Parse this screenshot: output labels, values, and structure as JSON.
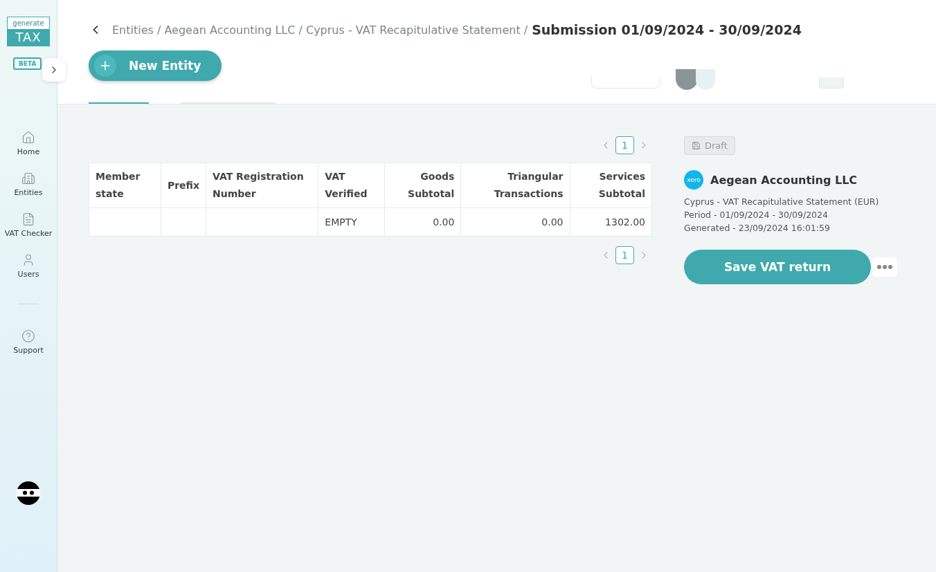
{
  "sidebar": {
    "logo_top": "generate",
    "logo_bottom": "TAX",
    "badge": "BETA",
    "items": [
      {
        "label": "Home"
      },
      {
        "label": "Entities"
      },
      {
        "label": "VAT Checker"
      },
      {
        "label": "Users"
      }
    ],
    "support": {
      "label": "Support"
    }
  },
  "breadcrumb": {
    "path": "Entities / Aegean Accounting LLC / Cyprus - VAT Recapitulative Statement /",
    "current": "Submission 01/09/2024 - 30/09/2024"
  },
  "new_entity_button": "New Entity",
  "tabs": [
    {
      "selected": true
    },
    {
      "selected": false
    }
  ],
  "pagination_top": {
    "page": "1"
  },
  "table": {
    "columns": [
      "Member state",
      "Prefix",
      "VAT Registration Number",
      "VAT Verified",
      "Goods Subtotal",
      "Triangular Transactions",
      "Services Subtotal"
    ],
    "rows": [
      [
        "",
        "",
        "",
        "EMPTY",
        "0.00",
        "0.00",
        "1302.00"
      ]
    ]
  },
  "pagination_bottom": {
    "page": "1"
  },
  "panel": {
    "status": "Draft",
    "entity": "Aegean Accounting LLC",
    "logo": "xero",
    "details": [
      "Cyprus - VAT Recapitulative Statement (EUR)",
      "Period - 01/09/2024 - 30/09/2024",
      "Generated - 23/09/2024 16:01:59"
    ],
    "save_button": "Save VAT return"
  }
}
